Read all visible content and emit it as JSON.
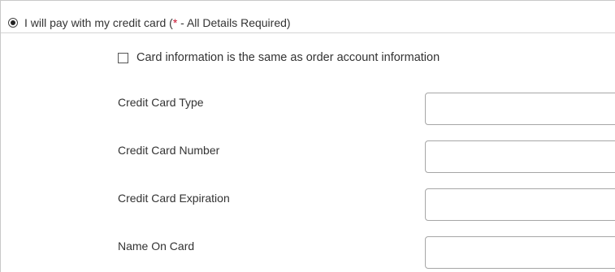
{
  "payment_option": {
    "label_prefix": "I will pay with my credit card (",
    "asterisk": "*",
    "label_suffix": " - All Details Required)",
    "selected": true
  },
  "same_as_account": {
    "label": "Card information is the same as order account information",
    "checked": false
  },
  "fields": [
    {
      "label": "Credit Card Type",
      "value": ""
    },
    {
      "label": "Credit Card Number",
      "value": ""
    },
    {
      "label": "Credit Card Expiration",
      "value": ""
    },
    {
      "label": "Name On Card",
      "value": ""
    }
  ],
  "colors": {
    "required_asterisk": "#c8102e",
    "text": "#333333",
    "input_border": "#a6a6a6"
  }
}
